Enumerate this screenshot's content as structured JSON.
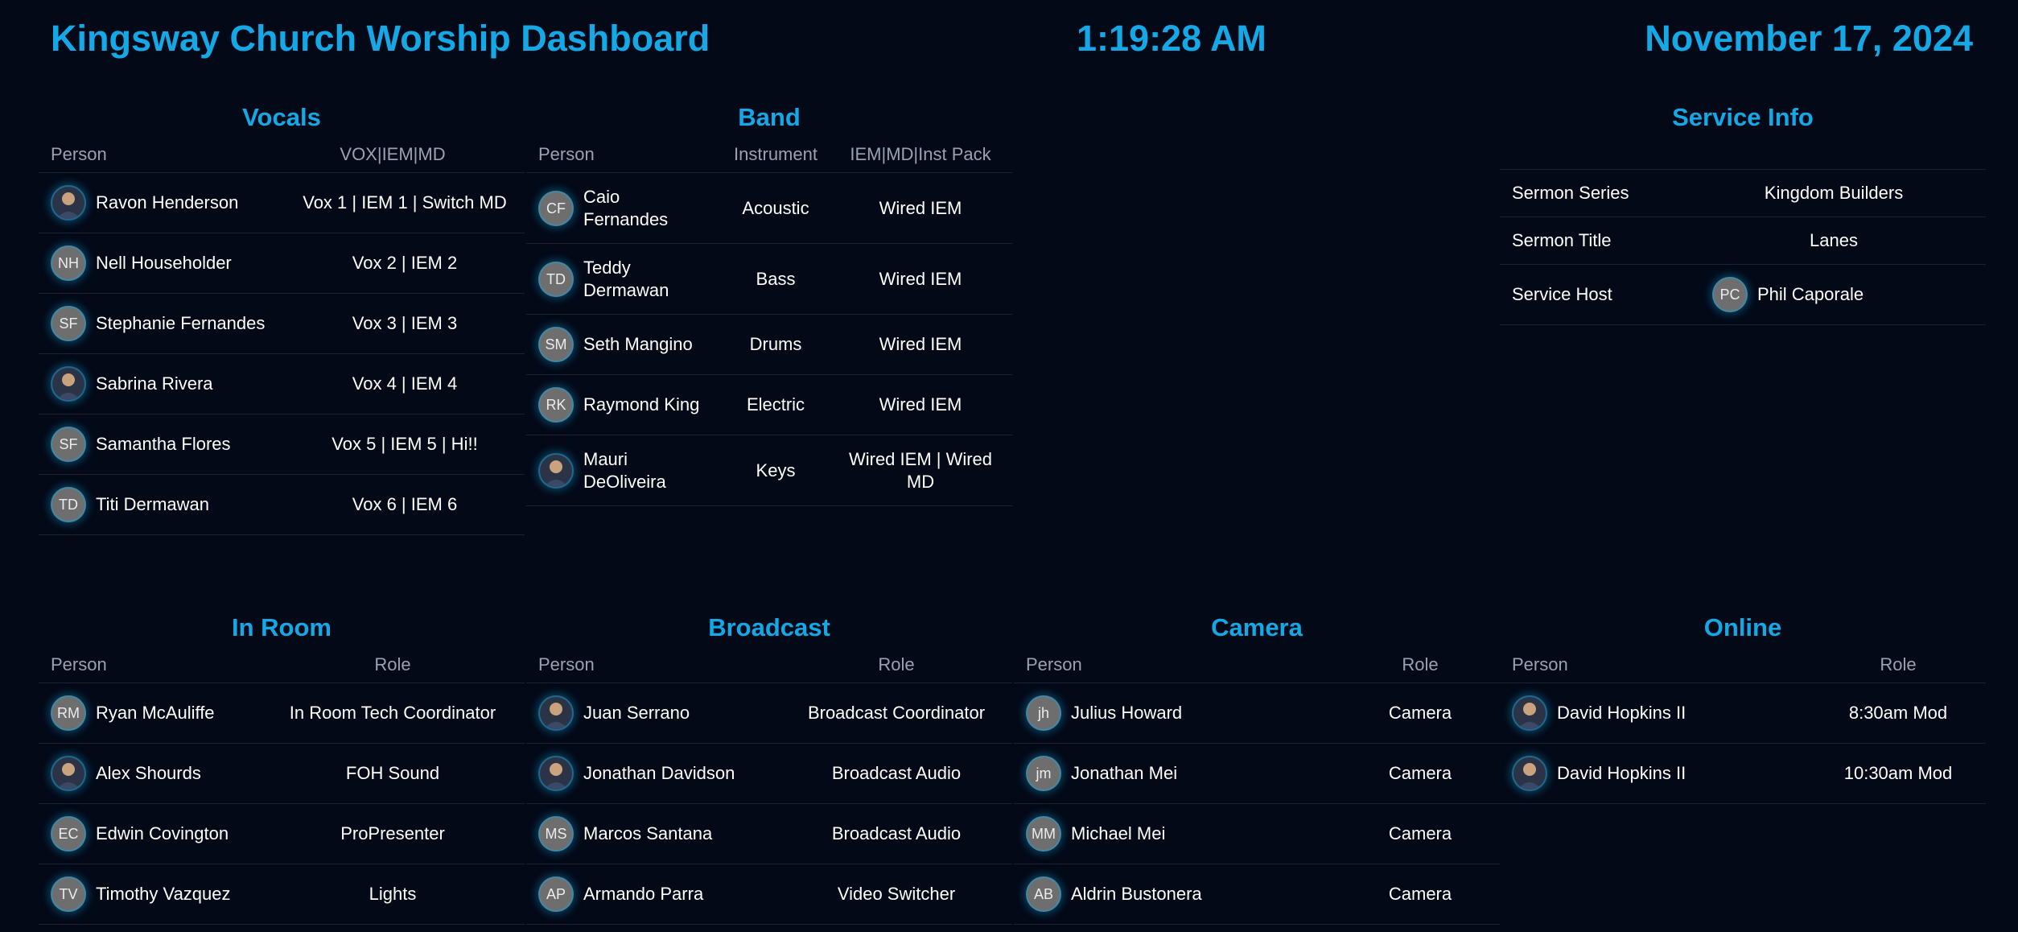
{
  "header": {
    "title": "Kingsway Church Worship Dashboard",
    "time": "1:19:28 AM",
    "date": "November 17, 2024"
  },
  "vocals": {
    "title": "Vocals",
    "headers": {
      "person": "Person",
      "assign": "VOX|IEM|MD"
    },
    "rows": [
      {
        "initials": "",
        "avatar": "photo-avatar",
        "name": "Ravon Henderson",
        "assign": "Vox 1 | IEM 1 | Switch MD"
      },
      {
        "initials": "NH",
        "name": "Nell Householder",
        "assign": "Vox 2 | IEM 2"
      },
      {
        "initials": "SF",
        "name": "Stephanie Fernandes",
        "assign": "Vox 3 | IEM 3"
      },
      {
        "initials": "",
        "avatar": "photo-avatar",
        "name": "Sabrina Rivera",
        "assign": "Vox 4 | IEM 4"
      },
      {
        "initials": "SF",
        "name": "Samantha Flores",
        "assign": "Vox 5 | IEM 5 | Hi!!"
      },
      {
        "initials": "TD",
        "name": "Titi Dermawan",
        "assign": "Vox 6 | IEM 6"
      }
    ]
  },
  "band": {
    "title": "Band",
    "headers": {
      "person": "Person",
      "instrument": "Instrument",
      "pack": "IEM|MD|Inst Pack"
    },
    "rows": [
      {
        "initials": "CF",
        "name": "Caio Fernandes",
        "instrument": "Acoustic",
        "pack": "Wired IEM"
      },
      {
        "initials": "TD",
        "name": "Teddy Dermawan",
        "instrument": "Bass",
        "pack": "Wired IEM"
      },
      {
        "initials": "SM",
        "name": "Seth Mangino",
        "instrument": "Drums",
        "pack": "Wired IEM"
      },
      {
        "initials": "RK",
        "name": "Raymond King",
        "instrument": "Electric",
        "pack": "Wired IEM"
      },
      {
        "initials": "",
        "avatar": "photo-avatar",
        "name": "Mauri DeOliveira",
        "instrument": "Keys",
        "pack": "Wired IEM | Wired MD"
      }
    ]
  },
  "service": {
    "title": "Service Info",
    "rows": [
      {
        "label": "Sermon Series",
        "value": "Kingdom Builders"
      },
      {
        "label": "Sermon Title",
        "value": "Lanes"
      },
      {
        "label": "Service Host",
        "initials": "PC",
        "value": "Phil Caporale"
      }
    ]
  },
  "inroom": {
    "title": "In Room",
    "headers": {
      "person": "Person",
      "role": "Role"
    },
    "rows": [
      {
        "initials": "RM",
        "name": "Ryan McAuliffe",
        "role": "In Room Tech Coordinator"
      },
      {
        "initials": "",
        "avatar": "photo-avatar",
        "name": "Alex Shourds",
        "role": "FOH Sound"
      },
      {
        "initials": "EC",
        "name": "Edwin Covington",
        "role": "ProPresenter"
      },
      {
        "initials": "TV",
        "name": "Timothy Vazquez",
        "role": "Lights"
      }
    ]
  },
  "broadcast": {
    "title": "Broadcast",
    "headers": {
      "person": "Person",
      "role": "Role"
    },
    "rows": [
      {
        "initials": "",
        "avatar": "photo-avatar",
        "name": "Juan Serrano",
        "role": "Broadcast Coordinator"
      },
      {
        "initials": "",
        "avatar": "photo-avatar",
        "name": "Jonathan Davidson",
        "role": "Broadcast Audio"
      },
      {
        "initials": "MS",
        "name": "Marcos Santana",
        "role": "Broadcast Audio"
      },
      {
        "initials": "AP",
        "name": "Armando Parra",
        "role": "Video Switcher"
      }
    ]
  },
  "camera": {
    "title": "Camera",
    "headers": {
      "person": "Person",
      "role": "Role"
    },
    "rows": [
      {
        "initials": "jh",
        "name": "Julius Howard",
        "role": "Camera"
      },
      {
        "initials": "jm",
        "name": "Jonathan Mei",
        "role": "Camera"
      },
      {
        "initials": "MM",
        "name": "Michael Mei",
        "role": "Camera"
      },
      {
        "initials": "AB",
        "name": "Aldrin Bustonera",
        "role": "Camera"
      }
    ]
  },
  "online": {
    "title": "Online",
    "headers": {
      "person": "Person",
      "role": "Role"
    },
    "rows": [
      {
        "initials": "",
        "avatar": "photo-avatar",
        "name": "David Hopkins II",
        "role": "8:30am Mod"
      },
      {
        "initials": "",
        "avatar": "photo-avatar",
        "name": "David Hopkins II",
        "role": "10:30am Mod"
      }
    ]
  }
}
